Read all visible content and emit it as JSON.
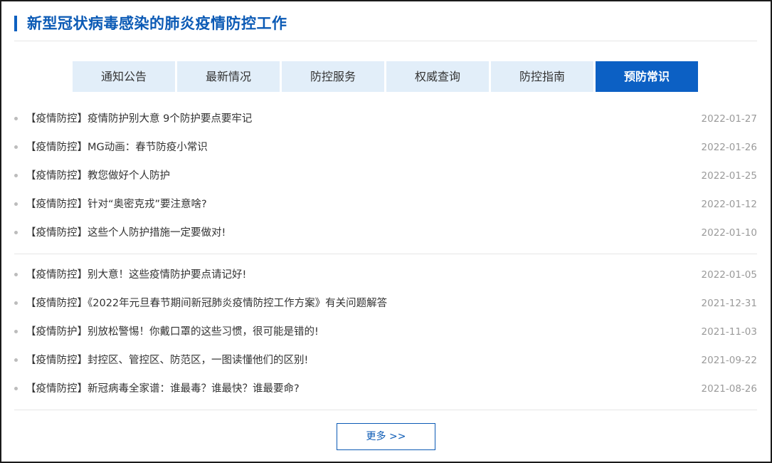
{
  "header": {
    "title": "新型冠状病毒感染的肺炎疫情防控工作"
  },
  "tabs": [
    {
      "label": "通知公告",
      "active": false
    },
    {
      "label": "最新情况",
      "active": false
    },
    {
      "label": "防控服务",
      "active": false
    },
    {
      "label": "权威查询",
      "active": false
    },
    {
      "label": "防控指南",
      "active": false
    },
    {
      "label": "预防常识",
      "active": true
    }
  ],
  "news_group_1": [
    {
      "title": "【疫情防控】疫情防护别大意 9个防护要点要牢记",
      "date": "2022-01-27"
    },
    {
      "title": "【疫情防控】MG动画：春节防疫小常识",
      "date": "2022-01-26"
    },
    {
      "title": "【疫情防控】教您做好个人防护",
      "date": "2022-01-25"
    },
    {
      "title": "【疫情防控】针对“奥密克戎”要注意啥?",
      "date": "2022-01-12"
    },
    {
      "title": "【疫情防控】这些个人防护措施一定要做对!",
      "date": "2022-01-10"
    }
  ],
  "news_group_2": [
    {
      "title": "【疫情防控】别大意！这些疫情防护要点请记好!",
      "date": "2022-01-05"
    },
    {
      "title": "【疫情防控】《2022年元旦春节期间新冠肺炎疫情防控工作方案》有关问题解答",
      "date": "2021-12-31"
    },
    {
      "title": "【疫情防护】别放松警惕！你戴口罩的这些习惯，很可能是错的!",
      "date": "2021-11-03"
    },
    {
      "title": "【疫情防控】封控区、管控区、防范区，一图读懂他们的区别!",
      "date": "2021-09-22"
    },
    {
      "title": "【疫情防控】新冠病毒全家谱：谁最毒？谁最快？谁最要命?",
      "date": "2021-08-26"
    }
  ],
  "more_button": {
    "label": "更多 >>"
  },
  "colors": {
    "accent": "#0b5ab5",
    "tab_active_bg": "#0c60c4",
    "tab_bg": "#e2eef9",
    "date_text": "#9a9a9a"
  }
}
